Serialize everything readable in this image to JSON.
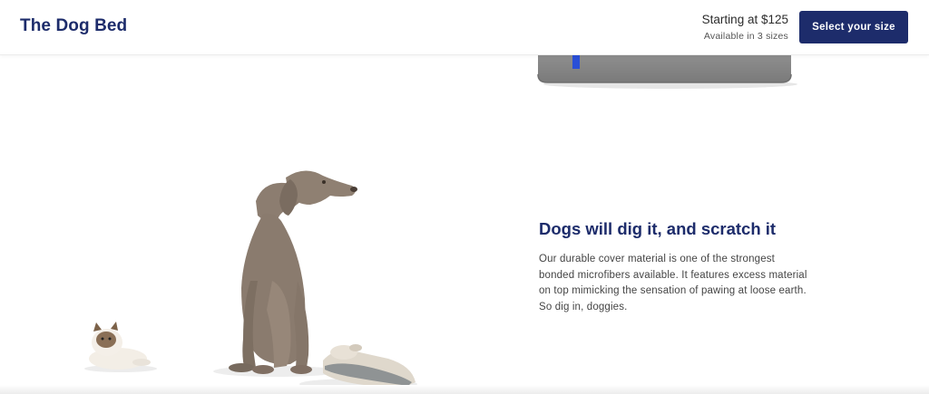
{
  "header": {
    "title": "The Dog Bed",
    "price": "Starting at $125",
    "sizes_note": "Available in 3 sizes",
    "cta_label": "Select your size"
  },
  "feature": {
    "heading": "Dogs will dig it, and scratch it",
    "body": "Our durable cover material is one of the strongest bonded microfibers available. It features excess material on top mimicking the sensation of pawing at loose earth. So dig in, doggies."
  },
  "colors": {
    "brand_navy": "#1d2c6b",
    "bed_gray": "#8d8d8d",
    "dog_brown": "#8a7b6e",
    "tag_blue": "#2a4fd6"
  },
  "images": {
    "bed": "product-bed-image",
    "dog": "weimaraner-dog-image",
    "cat": "cat-toy-image",
    "chew": "chewed-foam-image"
  }
}
